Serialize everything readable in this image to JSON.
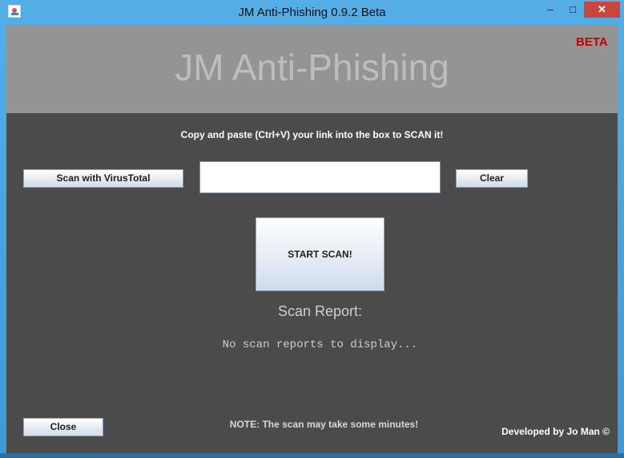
{
  "window": {
    "title": "JM Anti-Phishing 0.9.2 Beta",
    "controls": {
      "minimize": "–",
      "maximize": "□",
      "close": "✕"
    }
  },
  "header": {
    "app_name": "JM Anti-Phishing",
    "badge": "BETA"
  },
  "main": {
    "instruction": "Copy and paste (Ctrl+V) your link into the box to SCAN it!",
    "virustotal_button": "Scan with VirusTotal",
    "url_input": {
      "value": "",
      "placeholder": ""
    },
    "clear_button": "Clear",
    "start_button": "START SCAN!",
    "report_title": "Scan Report:",
    "report_text": "No scan reports to display..."
  },
  "footer": {
    "close_button": "Close",
    "note": "NOTE: The scan may take some minutes!",
    "credit": "Developed by Jo Man ©"
  },
  "colors": {
    "header_bg": "#949494",
    "body_bg": "#4b4b4b",
    "beta": "#c00000",
    "window_border": "#4aa0dc"
  }
}
